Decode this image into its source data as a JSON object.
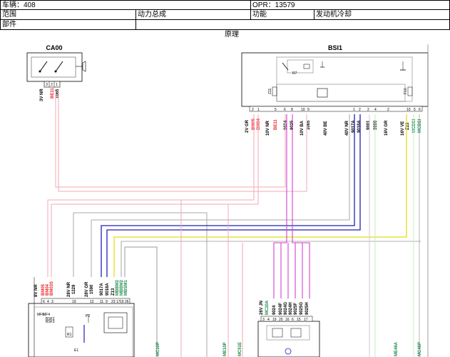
{
  "header": {
    "vehicle": "车辆：408",
    "opr": "OPR：13579",
    "scope_label": "范围",
    "scope_value": "动力总成",
    "function_label": "功能",
    "function_value": "发动机冷却",
    "part_label": "部件",
    "principle_label": "原理"
  },
  "modules": {
    "ca00": "CA00",
    "bsi1": "BSI1",
    "bsi1_inner_label": "R7"
  },
  "ca00_connector": {
    "label": "3V NR",
    "pins": [
      "3",
      "2",
      "1"
    ],
    "wires": [
      "BE11",
      "1065"
    ]
  },
  "bsi1_connectors": [
    {
      "label": "2V GR",
      "pins": [
        "2",
        "1"
      ],
      "wires": [
        "BM05",
        "BM04"
      ]
    },
    {
      "label": "10V NR",
      "pins": [
        "5",
        "6"
      ],
      "wires": [
        "BE11",
        "9024"
      ]
    },
    {
      "label": "",
      "pins": [
        "8"
      ],
      "wires": [
        "9025"
      ]
    },
    {
      "label": "10V BA",
      "pins": [
        "10",
        "9"
      ],
      "wires": [
        "1065"
      ]
    },
    {
      "label": "40V BE",
      "pins": [],
      "wires": []
    },
    {
      "label": "40V NR",
      "pins": [
        "1",
        "2"
      ],
      "wires": [
        "9017A",
        "9018A"
      ]
    },
    {
      "label": "",
      "pins": [
        "2",
        "4"
      ],
      "wires": [
        "9001",
        "9000"
      ]
    },
    {
      "label": "16V GR",
      "pins": [
        "2"
      ],
      "wires": []
    },
    {
      "label": "16V VE",
      "pins": [
        "10",
        "5",
        "6"
      ],
      "wires": [
        "Z13",
        "MCBSI",
        "MCBSI"
      ]
    }
  ],
  "bsi1_internal": {
    "f1": "Z11",
    "f2": "F10"
  },
  "bottom_left_connectors": [
    {
      "label": "8V NR",
      "pins": [
        "6",
        "4",
        "3"
      ],
      "wires": [
        "BM05",
        "BM04",
        "BM03S"
      ]
    },
    {
      "label": "28V NR",
      "pins": [
        "19"
      ],
      "wires": [
        "1229"
      ]
    },
    {
      "label": "28V GR",
      "pins": [
        "12"
      ],
      "wires": [
        "1590"
      ]
    },
    {
      "label": "",
      "pins": [
        "11",
        "9",
        "23",
        "17",
        "19",
        "26"
      ],
      "wires": [
        "9017A",
        "9018A",
        "Z13",
        "MBBM2",
        "MBBM2",
        "MBSM1"
      ]
    }
  ],
  "bottom_left_internal": {
    "p1": "MF6",
    "p2": "MF4",
    "p3": "BSF2",
    "p4": "BSF3",
    "p5": "P2",
    "p6": "R1",
    "p7": "E1"
  },
  "bottom_right_connector": {
    "label": "26V JN",
    "pins": [
      "3",
      "4",
      "19",
      "20",
      "16",
      "6",
      "15",
      "17"
    ],
    "wires": [
      "MC20A",
      "9024",
      "9024F",
      "9024G",
      "9024H",
      "9025F",
      "9025G",
      "9025H"
    ]
  },
  "bottom_labels": [
    "MC10P",
    "ME10P",
    "MC51E",
    "ME46A",
    "MC46P"
  ]
}
